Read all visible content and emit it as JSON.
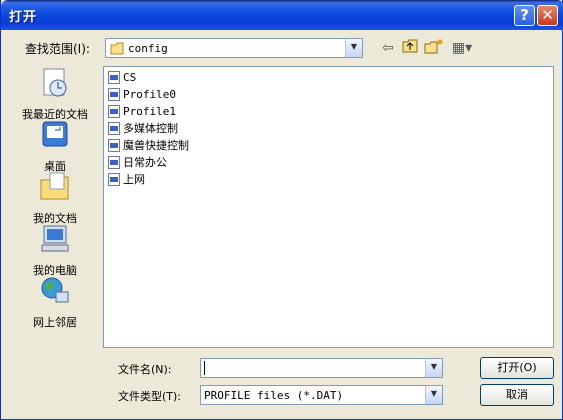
{
  "window": {
    "title": "打开",
    "help_glyph": "?",
    "close_glyph": "✕"
  },
  "lookin": {
    "label": "查找范围(I):",
    "value": "config"
  },
  "toolbar": {
    "back": "⇦",
    "up": "↰",
    "new_folder": "✶",
    "views": "▦▾"
  },
  "places": [
    {
      "label": "我最近的文档",
      "icon": "recent-documents-icon"
    },
    {
      "label": "桌面",
      "icon": "desktop-icon"
    },
    {
      "label": "我的文档",
      "icon": "my-documents-icon"
    },
    {
      "label": "我的电脑",
      "icon": "my-computer-icon"
    },
    {
      "label": "网上邻居",
      "icon": "network-icon"
    }
  ],
  "files": [
    "CS",
    "Profile0",
    "Profile1",
    "多媒体控制",
    "魔兽快捷控制",
    "日常办公",
    "上网"
  ],
  "filename": {
    "label": "文件名(N):",
    "value": ""
  },
  "filetype": {
    "label": "文件类型(T):",
    "value": "PROFILE files (*.DAT)"
  },
  "buttons": {
    "open": "打开(O)",
    "cancel": "取消"
  }
}
